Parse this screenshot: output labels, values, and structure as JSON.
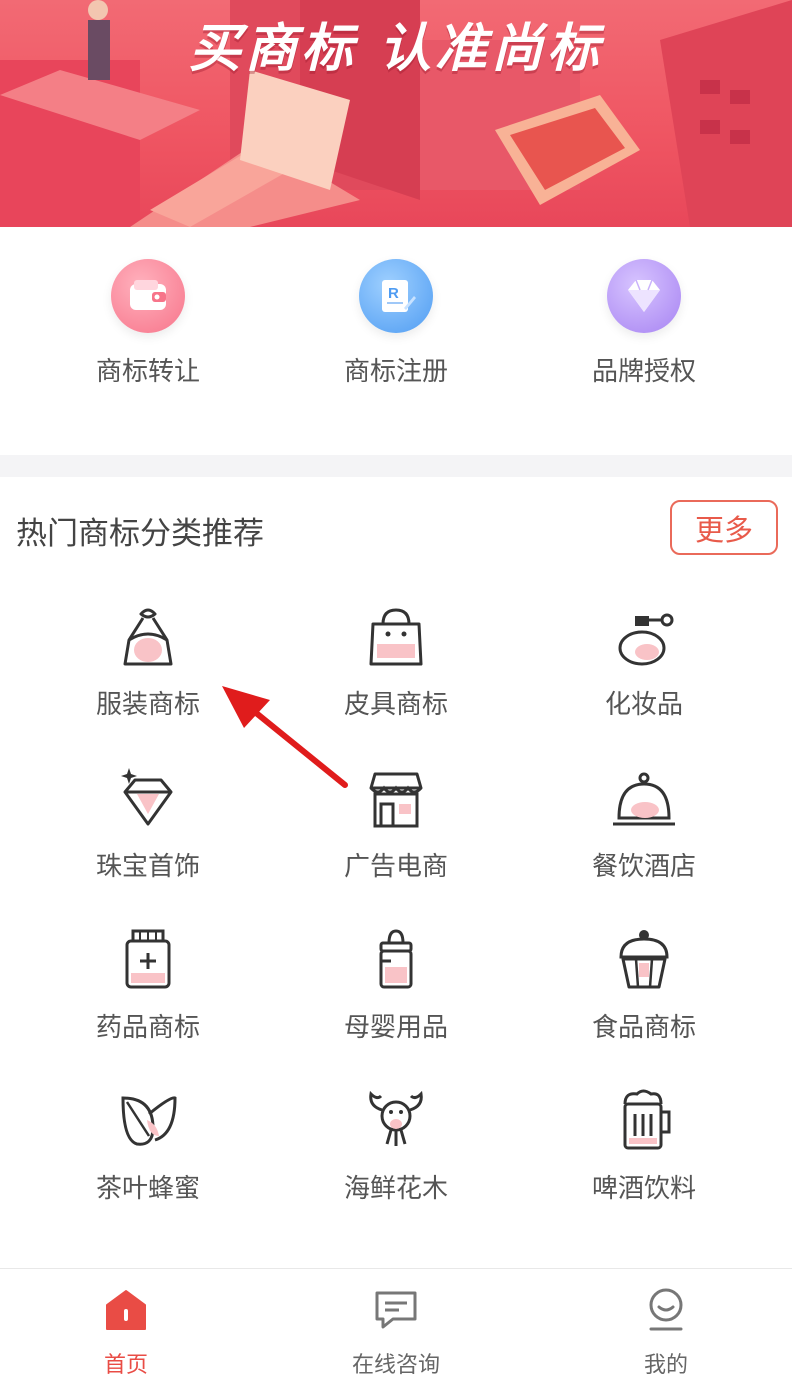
{
  "banner": {
    "title": "买商标  认准尚标"
  },
  "services": [
    {
      "label": "商标转让",
      "icon": "wallet-icon",
      "color": "#f7748a"
    },
    {
      "label": "商标注册",
      "icon": "registered-doc-icon",
      "color": "#4f9cf2"
    },
    {
      "label": "品牌授权",
      "icon": "diamond-icon",
      "color": "#a783f2"
    }
  ],
  "hot": {
    "title": "热门商标分类推荐",
    "more_label": "更多",
    "categories": [
      {
        "label": "服装商标",
        "icon": "dress-icon"
      },
      {
        "label": "皮具商标",
        "icon": "handbag-icon"
      },
      {
        "label": "化妆品",
        "icon": "perfume-icon"
      },
      {
        "label": "珠宝首饰",
        "icon": "gem-icon"
      },
      {
        "label": "广告电商",
        "icon": "storefront-icon"
      },
      {
        "label": "餐饮酒店",
        "icon": "cloche-icon"
      },
      {
        "label": "药品商标",
        "icon": "medicine-bottle-icon"
      },
      {
        "label": "母婴用品",
        "icon": "baby-bottle-icon"
      },
      {
        "label": "食品商标",
        "icon": "cupcake-icon"
      },
      {
        "label": "茶叶蜂蜜",
        "icon": "tea-leaf-icon"
      },
      {
        "label": "海鲜花木",
        "icon": "lobster-icon"
      },
      {
        "label": "啤酒饮料",
        "icon": "beer-mug-icon"
      }
    ]
  },
  "nav": [
    {
      "label": "首页",
      "icon": "home-icon",
      "active": true
    },
    {
      "label": "在线咨询",
      "icon": "chat-icon",
      "active": false
    },
    {
      "label": "我的",
      "icon": "profile-icon",
      "active": false
    }
  ],
  "colors": {
    "accent": "#e94c45",
    "more_border": "#ea6a5a",
    "banner": "#ef5562"
  }
}
